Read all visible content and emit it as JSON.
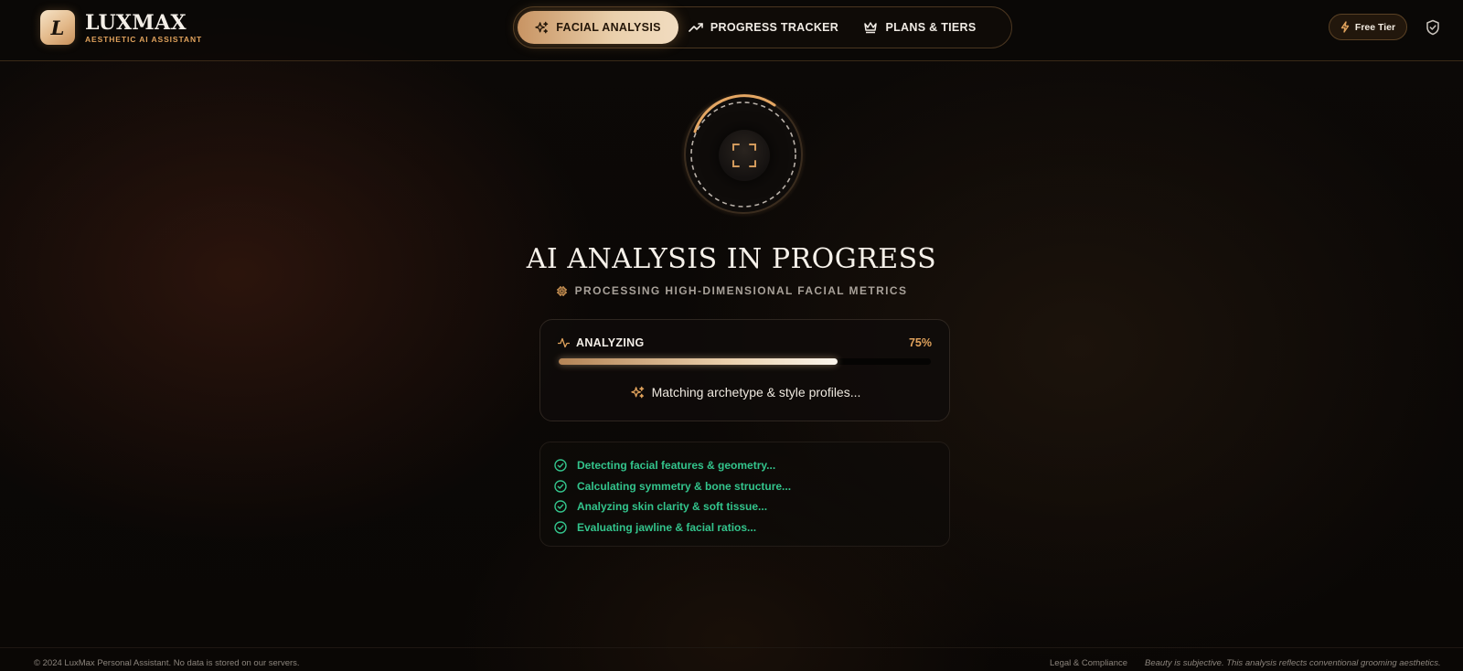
{
  "brand": {
    "logo_letter": "L",
    "name": "LUXMAX",
    "tagline": "AESTHETIC AI ASSISTANT"
  },
  "nav": {
    "tabs": [
      {
        "label": "FACIAL ANALYSIS",
        "icon": "sparkles-icon",
        "active": true
      },
      {
        "label": "PROGRESS TRACKER",
        "icon": "trending-up-icon",
        "active": false
      },
      {
        "label": "PLANS & TIERS",
        "icon": "crown-icon",
        "active": false
      }
    ]
  },
  "header_actions": {
    "tier_label": "Free Tier",
    "tier_icon": "lightning-icon",
    "shield_icon": "shield-check-icon"
  },
  "scanner": {
    "icon": "face-scan-icon"
  },
  "main": {
    "title": "AI ANALYSIS IN PROGRESS",
    "subtitle": "PROCESSING HIGH-DIMENSIONAL FACIAL METRICS",
    "subtitle_icon": "cpu-chip-icon"
  },
  "progress": {
    "label": "ANALYZING",
    "label_icon": "activity-icon",
    "percent_text": "75%",
    "percent": 75,
    "status_text": "Matching archetype & style profiles...",
    "status_icon": "sparkles-icon"
  },
  "steps": [
    {
      "label": "Detecting facial features & geometry...",
      "icon": "check-circle-icon"
    },
    {
      "label": "Calculating symmetry & bone structure...",
      "icon": "check-circle-icon"
    },
    {
      "label": "Analyzing skin clarity & soft tissue...",
      "icon": "check-circle-icon"
    },
    {
      "label": "Evaluating jawline & facial ratios...",
      "icon": "check-circle-icon"
    }
  ],
  "footer": {
    "copyright": "© 2024 LuxMax Personal Assistant. No data is stored on our servers.",
    "legal_link": "Legal & Compliance",
    "disclaimer": "Beauty is subjective. This analysis reflects conventional grooming aesthetics."
  },
  "colors": {
    "accent_gold": "#e0a25c",
    "success_green": "#33c48c",
    "background": "#0b0806"
  }
}
